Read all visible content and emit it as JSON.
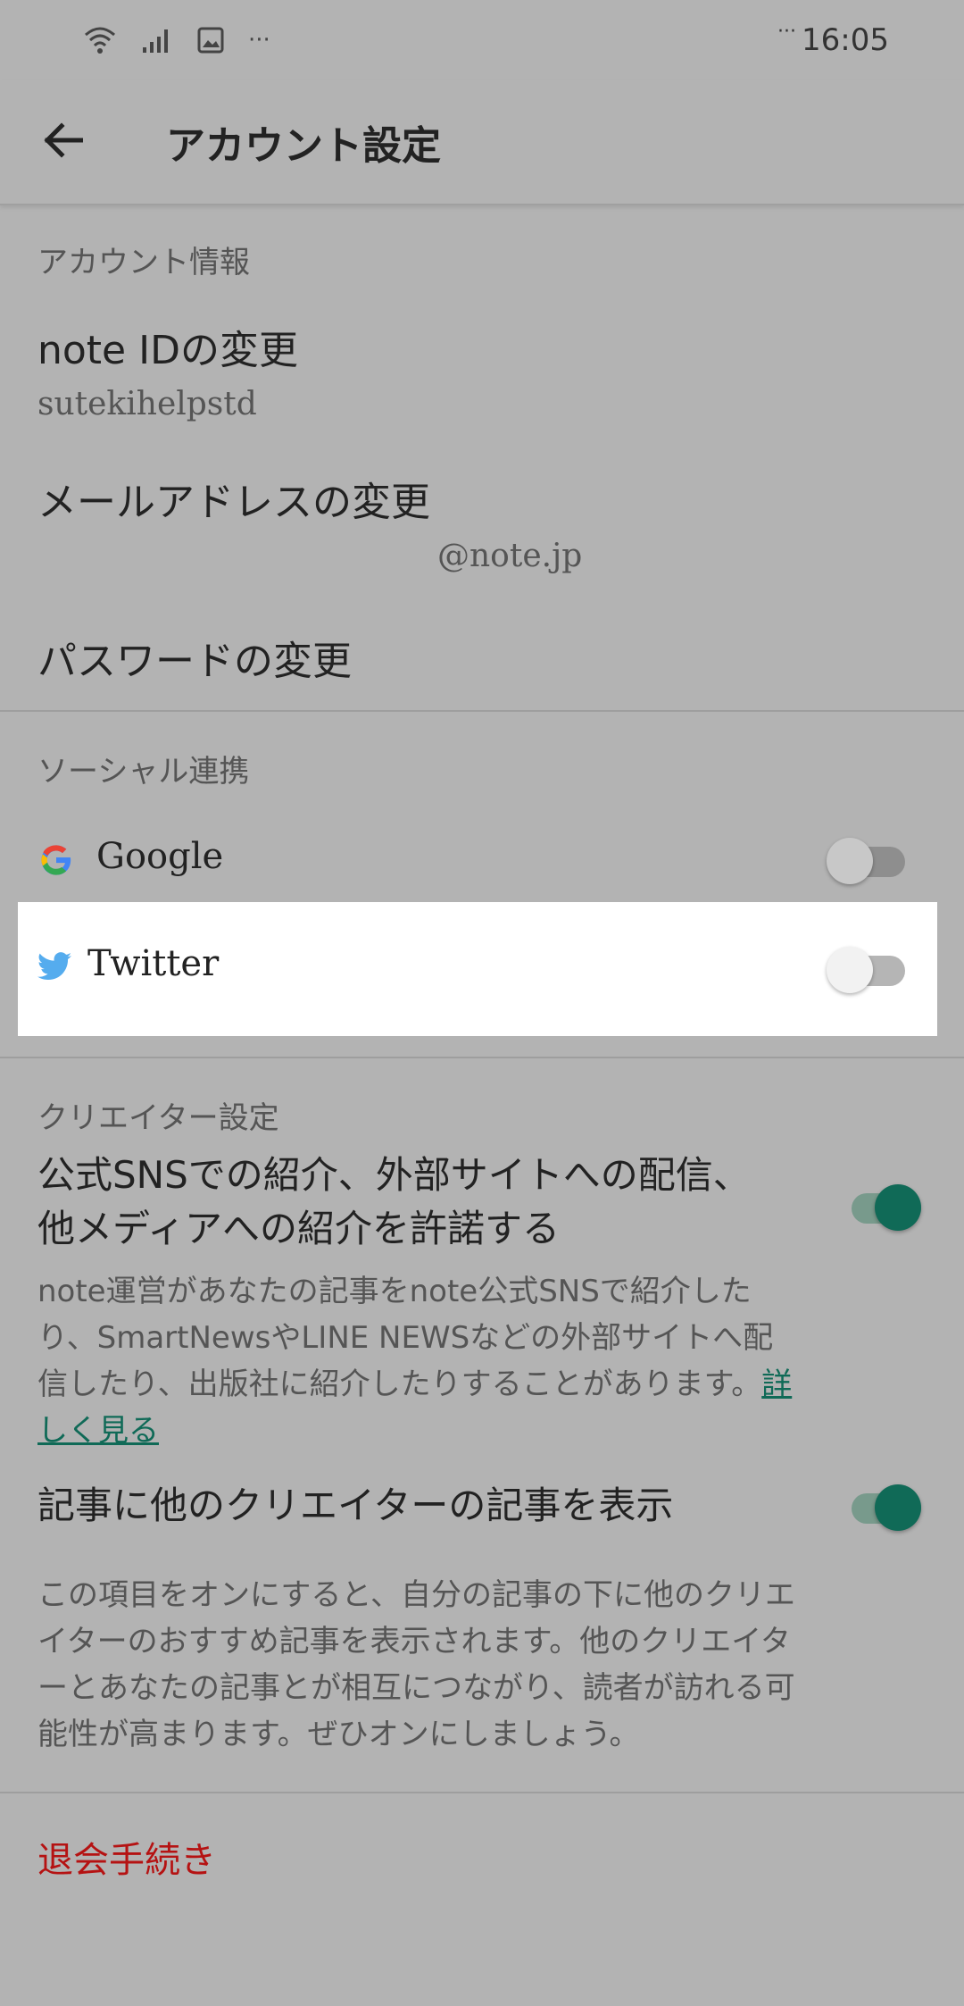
{
  "status_bar": {
    "time": "16:05",
    "notification_dots": "···",
    "icons": [
      "wifi-icon",
      "signal-icon",
      "image-icon",
      "more-dots-icon"
    ]
  },
  "app_bar": {
    "title": "アカウント設定",
    "back_icon": "arrow-back-icon"
  },
  "account_info": {
    "section_label": "アカウント情報",
    "note_id_title": "note IDの変更",
    "note_id_value": "sutekihelpstd",
    "email_title": "メールアドレスの変更",
    "email_value": "@note.jp",
    "password_title": "パスワードの変更"
  },
  "social": {
    "section_label": "ソーシャル連携",
    "google_label": "Google",
    "twitter_label": "Twitter",
    "google_enabled": false,
    "twitter_enabled": false
  },
  "creator": {
    "section_label": "クリエイター設定",
    "sns_title": "公式SNSでの紹介、外部サイトへの配信、他メディアへの紹介を許諾する",
    "sns_desc": "note運営があなたの記事をnote公式SNSで紹介したり、SmartNewsやLINE NEWSなどの外部サイトへ配信したり、出版社に紹介したりすることがあります。",
    "sns_link": "詳しく見る",
    "sns_enabled": true,
    "recommend_title": "記事に他のクリエイターの記事を表示",
    "recommend_desc": "この項目をオンにすると、自分の記事の下に他のクリエイターのおすすめ記事を表示されます。他のクリエイターとあなたの記事とが相互につながり、読者が訪れる可能性が高まります。ぜひオンにしましょう。",
    "recommend_enabled": true
  },
  "withdraw": {
    "label": "退会手続き"
  },
  "colors": {
    "accent": "#106a57",
    "danger": "#b51212",
    "twitter_blue": "#55acee",
    "background_dim": "#b3b3b3"
  }
}
